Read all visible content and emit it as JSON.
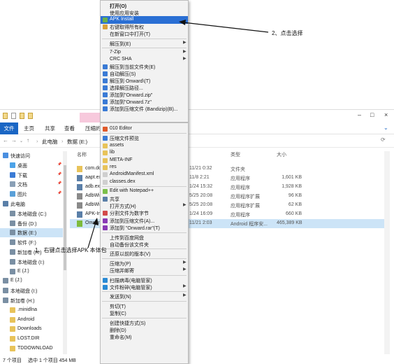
{
  "window": {
    "ribbon_tabs": [
      "文件",
      "主页",
      "共享",
      "查看",
      "压缩的"
    ],
    "breadcrumb": [
      "此电脑",
      "数据 (E:)"
    ],
    "controls": [
      "–",
      "□",
      "×"
    ]
  },
  "sidebar": {
    "items": [
      {
        "label": "快速访问",
        "color": "#4a8fe0",
        "pinned": false
      },
      {
        "label": "桌面",
        "color": "#4da3e8",
        "pinned": true
      },
      {
        "label": "下载",
        "color": "#3a7bd5",
        "pinned": true
      },
      {
        "label": "文档",
        "color": "#8aa0b6",
        "pinned": true
      },
      {
        "label": "图片",
        "color": "#5aa0d8",
        "pinned": true
      },
      {
        "label": "此电脑",
        "color": "#5a7fa8",
        "pinned": false
      },
      {
        "label": "本地磁盘 (C:)",
        "color": "#7a8fa3",
        "pinned": false
      },
      {
        "label": "备份 (D:)",
        "color": "#7a8fa3",
        "pinned": false
      },
      {
        "label": "数据 (E:)",
        "color": "#7a8fa3",
        "pinned": false,
        "selected": true
      },
      {
        "label": "软件 (F:)",
        "color": "#7a8fa3",
        "pinned": false
      },
      {
        "label": "新加卷 (H:)",
        "color": "#7a8fa3",
        "pinned": false
      },
      {
        "label": "本地磁盘 (I:)",
        "color": "#7a8fa3",
        "pinned": false
      },
      {
        "label": "E (J:)",
        "color": "#7a8fa3",
        "pinned": false
      },
      {
        "label": "E (J:)",
        "color": "#7a8fa3",
        "pinned": false
      },
      {
        "label": "本地磁盘 (I:)",
        "color": "#7a8fa3",
        "pinned": false
      },
      {
        "label": "新加卷 (H:)",
        "color": "#7a8fa3",
        "pinned": false
      },
      {
        "label": ".minidlna",
        "color": "#e8c35a",
        "pinned": false
      },
      {
        "label": "Android",
        "color": "#e8c35a",
        "pinned": false
      },
      {
        "label": "Downloads",
        "color": "#e8c35a",
        "pinned": false
      },
      {
        "label": "LOST.DIR",
        "color": "#e8c35a",
        "pinned": false
      },
      {
        "label": "TDDOWNLOAD",
        "color": "#e8c35a",
        "pinned": false
      }
    ]
  },
  "filelist": {
    "headers": {
      "name": "名称",
      "type": "类型",
      "size": "大小"
    },
    "rows": [
      {
        "name": "com.dc",
        "date": "11/21 0:32",
        "type": "文件夹",
        "size": "",
        "color": "#e8c35a"
      },
      {
        "name": "aapt.ex",
        "date": "11/8 2:21",
        "type": "应用程序",
        "size": "1,601 KB",
        "color": "#5a7fa8"
      },
      {
        "name": "adb.ex",
        "date": "1/24 15:32",
        "type": "应用程序",
        "size": "1,928 KB",
        "color": "#5a7fa8"
      },
      {
        "name": "AdbWi",
        "date": "5/25 20:08",
        "type": "应用程序扩展",
        "size": "96 KB",
        "color": "#8a8a8a"
      },
      {
        "name": "AdbWi",
        "date": "5/25 20:08",
        "type": "应用程序扩展",
        "size": "62 KB",
        "color": "#8a8a8a"
      },
      {
        "name": "APK-Ins",
        "date": "1/24 16:09",
        "type": "应用程序",
        "size": "660 KB",
        "color": "#5a7fa8"
      },
      {
        "name": "Onwar",
        "date": "11/21 2:03",
        "type": "Android 程序安...",
        "size": "465,389 KB",
        "color": "#7dbb3c",
        "selected": true
      }
    ]
  },
  "status": {
    "count": "7 个项目",
    "selection": "选中 1 个项目  454 MB"
  },
  "menu_top": [
    {
      "label": "打开(O)",
      "bold": true,
      "arrow": false
    },
    {
      "label": "使用应用安装",
      "arrow": false
    },
    {
      "label": "APK Install",
      "arrow": false,
      "highlight": true,
      "icon": "#6ab04c"
    },
    {
      "label": "右键取得所有权",
      "arrow": false,
      "icon": "#d9a13a"
    },
    {
      "label": "在新窗口中打开(T)",
      "arrow": false
    },
    {
      "sep": true
    },
    {
      "label": "解压到(E)",
      "arrow": true
    },
    {
      "sep": true
    },
    {
      "label": "7-Zip",
      "arrow": true
    },
    {
      "label": "CRC SHA",
      "arrow": true
    },
    {
      "label": "解压到当前文件夹(E)",
      "arrow": false,
      "icon": "#3a7bd5"
    },
    {
      "label": "自动解压(S)",
      "arrow": false,
      "icon": "#3a7bd5"
    },
    {
      "label": "解压到 Onward\\(T)",
      "arrow": false,
      "icon": "#3a7bd5"
    },
    {
      "label": "选择解压路径...",
      "arrow": false,
      "icon": "#3a7bd5"
    },
    {
      "label": "添加到\"Onward.zip\"",
      "arrow": false,
      "icon": "#3a7bd5"
    },
    {
      "label": "添加到\"Onward.7z\"",
      "arrow": false,
      "icon": "#3a7bd5"
    },
    {
      "label": "添加到压缩文件 (Bandizip)(B)...",
      "arrow": false,
      "icon": "#3a7bd5"
    }
  ],
  "menu_bottom": [
    {
      "label": "010 Editor",
      "arrow": false,
      "icon": "#e05a2a"
    },
    {
      "sep": true
    },
    {
      "label": "压缩文件预览",
      "arrow": false,
      "icon": "#3a7bd5"
    },
    {
      "label": "assets",
      "arrow": false,
      "icon": "#e8c35a"
    },
    {
      "label": "lib",
      "arrow": false,
      "icon": "#e8c35a"
    },
    {
      "label": "META-INF",
      "arrow": false,
      "icon": "#e8c35a"
    },
    {
      "label": "res",
      "arrow": false,
      "icon": "#e8c35a"
    },
    {
      "label": "AndroidManifest.xml",
      "arrow": false,
      "icon": "#cfcfcf"
    },
    {
      "label": "classes.dex",
      "arrow": false,
      "icon": "#cfcfcf"
    },
    {
      "sep": true
    },
    {
      "label": "Edit with Notepad++",
      "arrow": false,
      "icon": "#7bbf4a"
    },
    {
      "label": "共享",
      "arrow": false,
      "icon": "#5a7fa8"
    },
    {
      "label": "打开方式(H)",
      "arrow": true
    },
    {
      "label": "分割文件为数字节",
      "arrow": false,
      "icon": "#d24a4a"
    },
    {
      "label": "添加到压缩文件(A)...",
      "arrow": false,
      "icon": "#8a3ab5"
    },
    {
      "label": "添加到 \"Onward.rar\"(T)",
      "arrow": false,
      "icon": "#8a3ab5"
    },
    {
      "sep": true
    },
    {
      "label": "上传到百度网盘",
      "arrow": false
    },
    {
      "label": "自动备份该文件夹",
      "arrow": false
    },
    {
      "sep": true
    },
    {
      "label": "还原以前的版本(V)",
      "arrow": false
    },
    {
      "sep": true
    },
    {
      "label": "压缩为(P)",
      "arrow": true
    },
    {
      "label": "压缩并邮寄",
      "arrow": true
    },
    {
      "sep": true
    },
    {
      "label": "扫描病毒(电脑管家)",
      "arrow": false,
      "icon": "#2a8ad4"
    },
    {
      "label": "文件粉碎(电脑管家)",
      "arrow": true,
      "icon": "#2a8ad4"
    },
    {
      "sep": true
    },
    {
      "label": "发送到(N)",
      "arrow": true
    },
    {
      "sep": true
    },
    {
      "label": "剪切(T)",
      "arrow": false
    },
    {
      "label": "复制(C)",
      "arrow": false
    },
    {
      "sep": true
    },
    {
      "label": "创建快捷方式(S)",
      "arrow": false
    },
    {
      "label": "删除(D)",
      "arrow": false
    },
    {
      "label": "重命名(M)",
      "arrow": false
    }
  ],
  "annotations": {
    "step1": "1、右键点击选择APK 本体包",
    "step2": "2、点击选择"
  }
}
